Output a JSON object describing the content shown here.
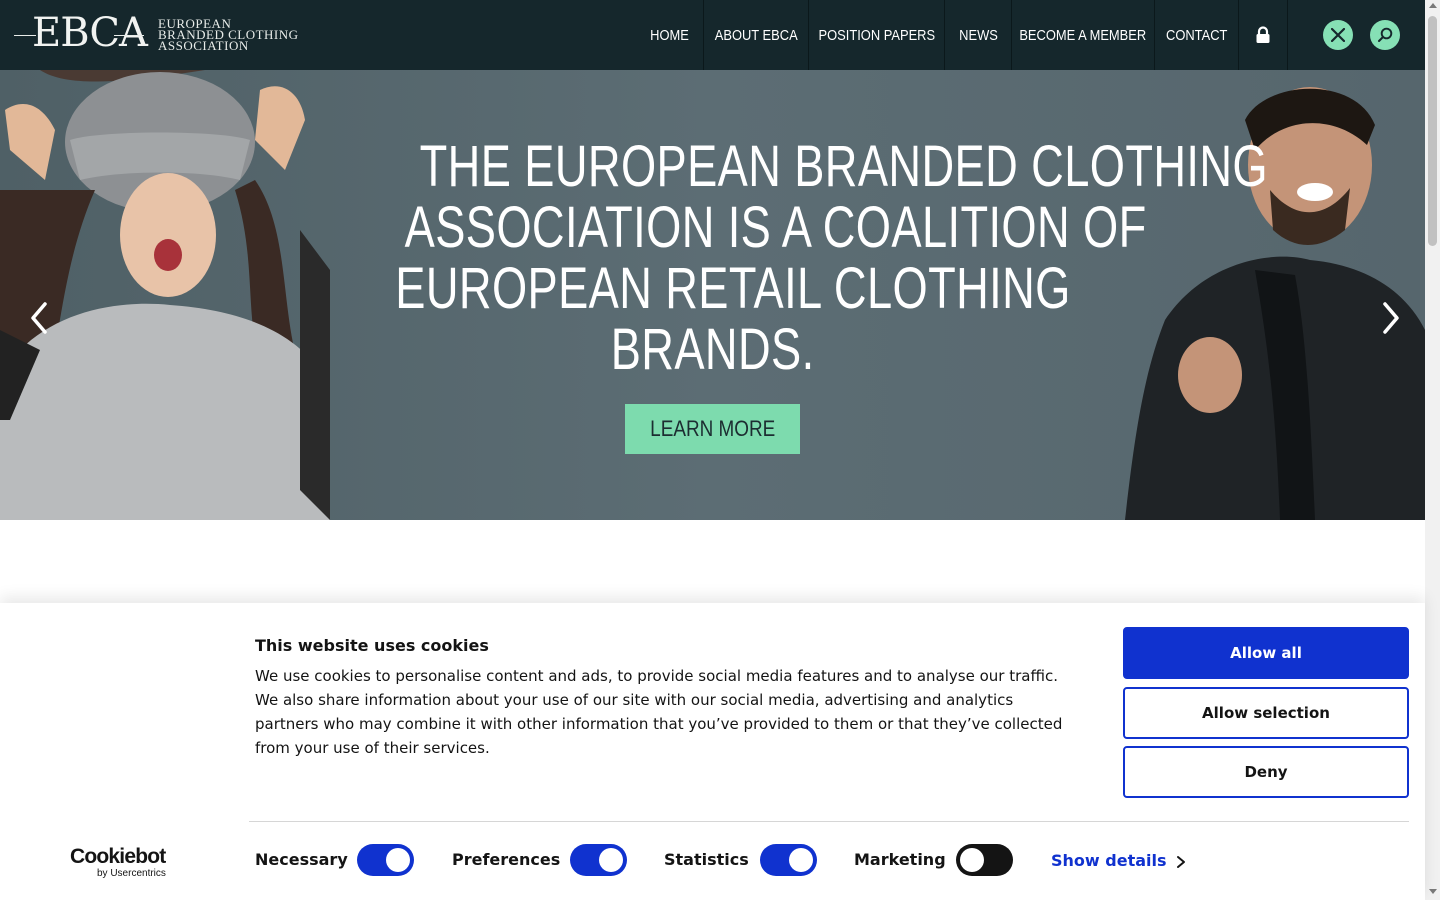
{
  "header": {
    "logo": {
      "letters": "EBCA",
      "lines": [
        "EUROPEAN",
        "BRANDED CLOTHING",
        "ASSOCIATION"
      ]
    },
    "nav": [
      "HOME",
      "ABOUT EBCA",
      "POSITION PAPERS",
      "NEWS",
      "BECOME A MEMBER",
      "CONTACT"
    ],
    "icons": [
      "lock-icon",
      "x-twitter-icon",
      "search-icon"
    ],
    "accent_color": "#86e0b5",
    "background_color": "#15272c"
  },
  "hero": {
    "title_lines": [
      "THE EUROPEAN BRANDED CLOTHING",
      "ASSOCIATION IS A COALITION OF",
      "EUROPEAN RETAIL CLOTHING",
      "BRANDS."
    ],
    "cta_label": "LEARN MORE",
    "cta_color": "#7ddbae"
  },
  "cookie_banner": {
    "title": "This website uses cookies",
    "text": "We use cookies to personalise content and ads, to provide social media features and to analyse our traffic. We also share information about your use of our site with our social media, advertising and analytics partners who may combine it with other information that you’ve provided to them or that they’ve collected from your use of their services.",
    "buttons": {
      "allow_all": "Allow all",
      "allow_selection": "Allow selection",
      "deny": "Deny"
    },
    "toggles": [
      {
        "label": "Necessary",
        "on": true
      },
      {
        "label": "Preferences",
        "on": true
      },
      {
        "label": "Statistics",
        "on": true
      },
      {
        "label": "Marketing",
        "on": false
      }
    ],
    "show_details": "Show details",
    "brand": {
      "name": "Cookiebot",
      "sub": "by Usercentrics"
    },
    "primary_color": "#1032cf"
  }
}
